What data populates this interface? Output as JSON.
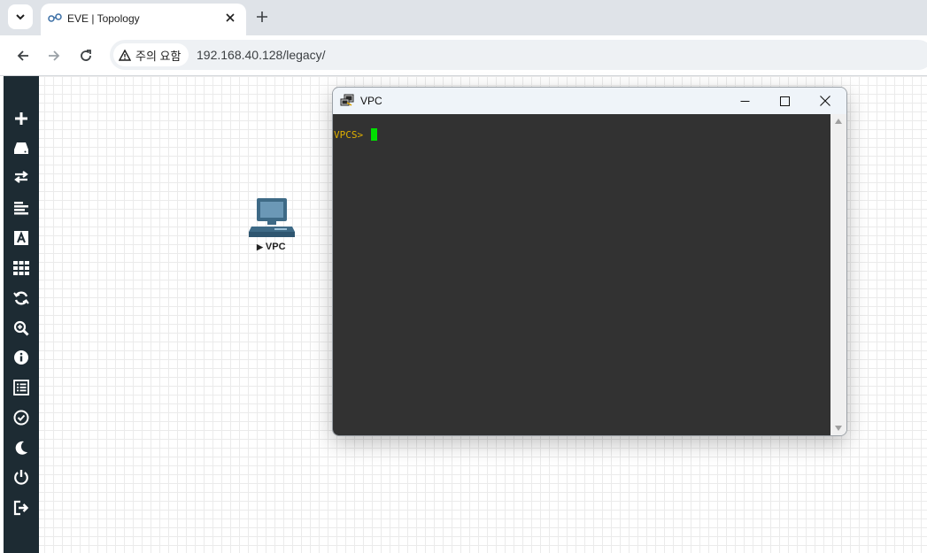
{
  "browser": {
    "tab": {
      "title": "EVE | Topology"
    },
    "address": {
      "security_label": "주의 요함",
      "url": "192.168.40.128/legacy/"
    }
  },
  "topology": {
    "node": {
      "name": "VPC",
      "icon": "pc-monitor-icon"
    }
  },
  "sidebar": {
    "items": [
      {
        "icon": "plus-icon"
      },
      {
        "icon": "hard-drive-icon"
      },
      {
        "icon": "exchange-arrows-icon"
      },
      {
        "icon": "align-left-icon"
      },
      {
        "icon": "font-icon"
      },
      {
        "icon": "grid-icon"
      },
      {
        "icon": "refresh-icon"
      },
      {
        "icon": "zoom-in-icon"
      },
      {
        "icon": "info-icon"
      },
      {
        "icon": "list-icon"
      },
      {
        "icon": "check-circle-icon"
      },
      {
        "icon": "moon-icon"
      },
      {
        "icon": "power-icon"
      },
      {
        "icon": "logout-icon"
      }
    ]
  },
  "terminal": {
    "title": "VPC",
    "prompt": "VPCS>"
  },
  "colors": {
    "sidebar_bg": "#1d2b33",
    "terminal_bg": "#323232",
    "prompt": "#e0b000",
    "cursor": "#00e000",
    "node": "#3e6a86"
  }
}
